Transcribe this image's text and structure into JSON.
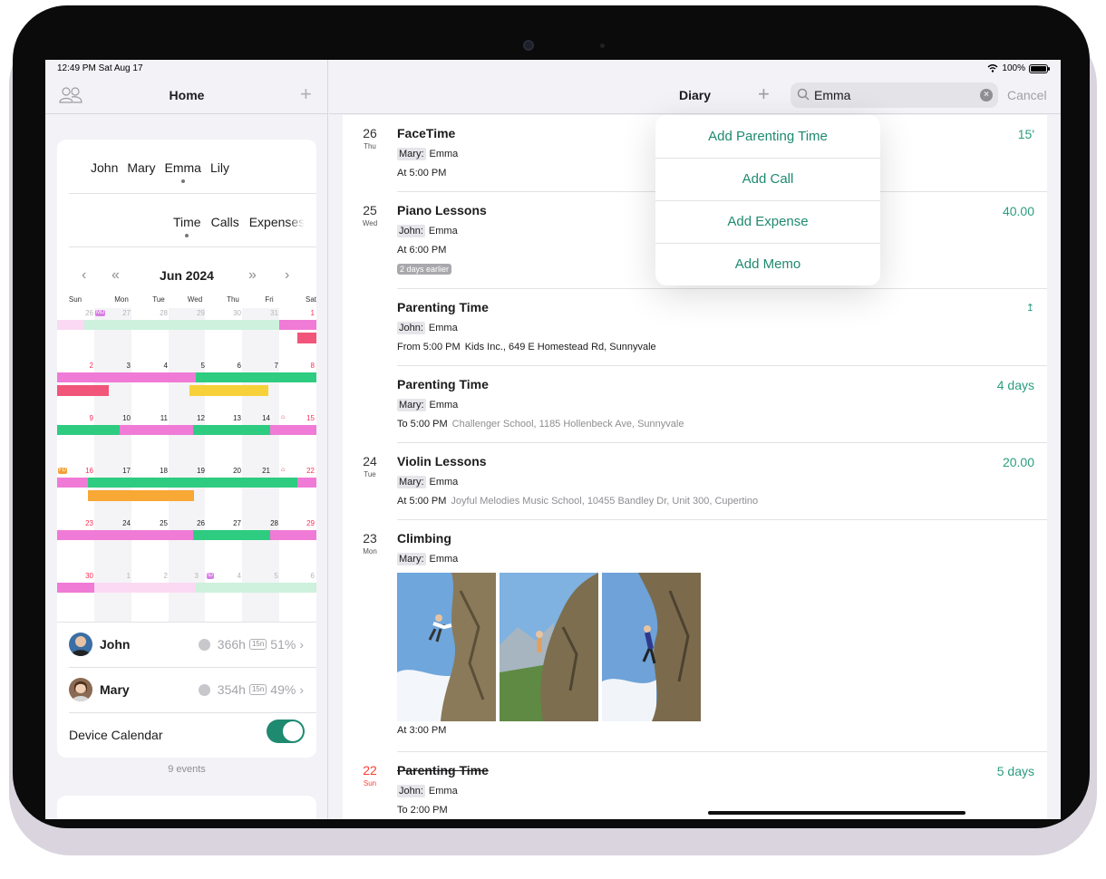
{
  "status": {
    "time": "12:49 PM  Sat Aug 17",
    "battery": "100%"
  },
  "sidebar": {
    "title": "Home",
    "members": [
      "John",
      "Mary",
      "Emma",
      "Lily"
    ],
    "categories": [
      "Time",
      "Calls",
      "Expenses"
    ],
    "calendar": {
      "month_label": "Jun 2024",
      "weekdays": [
        "Sun",
        "Mon",
        "Tue",
        "Wed",
        "Thu",
        "Fri",
        "Sat"
      ],
      "weeks": [
        [
          "26",
          "27",
          "28",
          "29",
          "30",
          "31",
          "1"
        ],
        [
          "2",
          "3",
          "4",
          "5",
          "6",
          "7",
          "8"
        ],
        [
          "9",
          "10",
          "11",
          "12",
          "13",
          "14",
          "15"
        ],
        [
          "16",
          "17",
          "18",
          "19",
          "20",
          "21",
          "22"
        ],
        [
          "23",
          "24",
          "25",
          "26",
          "27",
          "28",
          "29"
        ],
        [
          "30",
          "1",
          "2",
          "3",
          "4",
          "5",
          "6"
        ]
      ],
      "badges": {
        "md": "MD",
        "fd": "FD",
        "id": "ID"
      }
    },
    "people": [
      {
        "name": "John",
        "hours": "366h",
        "tag": "15n",
        "percent": "51%"
      },
      {
        "name": "Mary",
        "hours": "354h",
        "tag": "15n",
        "percent": "49%"
      }
    ],
    "device_calendar": {
      "label": "Device Calendar",
      "enabled": true
    },
    "events_count": "9 events"
  },
  "main": {
    "title": "Diary",
    "search": {
      "value": "Emma"
    },
    "cancel_label": "Cancel",
    "menu": [
      "Add Parenting Time",
      "Add Call",
      "Add Expense",
      "Add Memo"
    ],
    "entries": [
      {
        "day": "26",
        "weekday": "Thu",
        "title": "FaceTime",
        "who": "Mary:",
        "child": "Emma",
        "time": "At 5:00 PM",
        "place": "",
        "value": "15'"
      },
      {
        "day": "25",
        "weekday": "Wed",
        "title": "Piano Lessons",
        "who": "John:",
        "child": "Emma",
        "time": "At 6:00 PM",
        "place": "",
        "value": "40.00",
        "note": "2 days earlier"
      },
      {
        "day": "",
        "weekday": "",
        "title": "Parenting Time",
        "who": "John:",
        "child": "Emma",
        "time": "From 5:00 PM",
        "place": "Kids Inc., 649 E Homestead Rd, Sunnyvale",
        "value": "↥"
      },
      {
        "day": "",
        "weekday": "",
        "title": "Parenting Time",
        "who": "Mary:",
        "child": "Emma",
        "time": "To 5:00 PM",
        "place": "Challenger School, 1185 Hollenbeck Ave, Sunnyvale",
        "value": "4 days"
      },
      {
        "day": "24",
        "weekday": "Tue",
        "title": "Violin Lessons",
        "who": "Mary:",
        "child": "Emma",
        "time": "At 5:00 PM",
        "place": "Joyful Melodies Music School, 10455 Bandley Dr, Unit 300, Cupertino",
        "value": "20.00"
      },
      {
        "day": "23",
        "weekday": "Mon",
        "title": "Climbing",
        "who": "Mary:",
        "child": "Emma",
        "time": "At 3:00 PM",
        "place": "",
        "value": ""
      },
      {
        "day": "22",
        "weekday": "Sun",
        "title": "Parenting Time",
        "who": "John:",
        "child": "Emma",
        "time": "To 2:00 PM",
        "place": "",
        "value": "5 days"
      }
    ]
  },
  "colors": {
    "accent": "#2a9d7f",
    "pink": "#f07bd6",
    "green": "#2ecc80",
    "red": "#f2557a",
    "yellow": "#f7d13a",
    "orange": "#f7a835"
  }
}
